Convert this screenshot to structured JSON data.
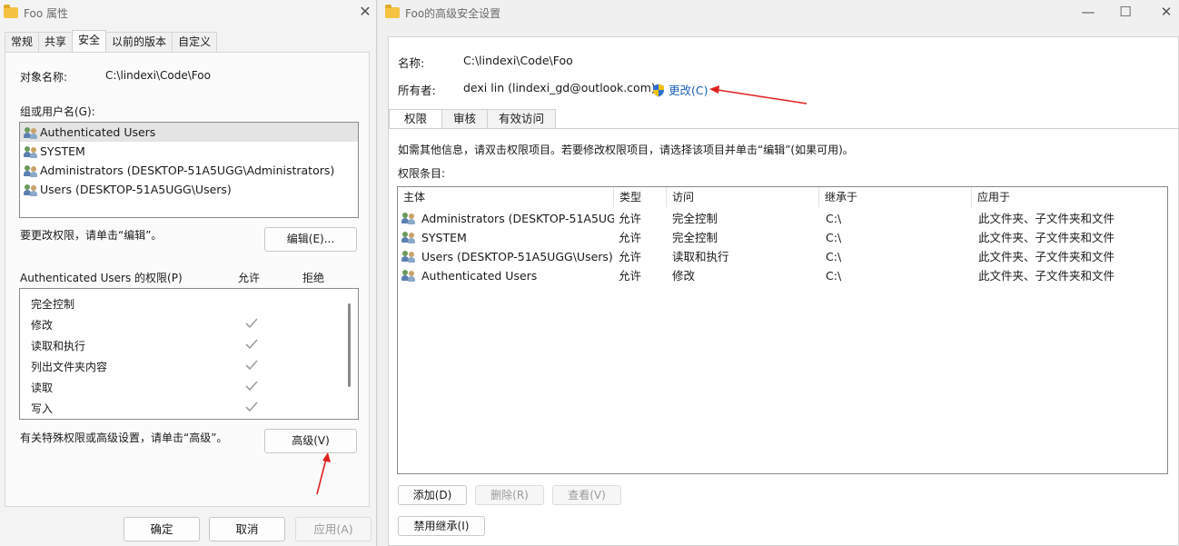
{
  "left_window": {
    "title": "Foo 属性",
    "close_glyph": "✕",
    "tabs": [
      "常规",
      "共享",
      "安全",
      "以前的版本",
      "自定义"
    ],
    "active_tab": "安全",
    "object_name_label": "对象名称:",
    "object_name_value": "C:\\lindexi\\Code\\Foo",
    "group_label": "组或用户名(G):",
    "users": [
      "Authenticated Users",
      "SYSTEM",
      "Administrators (DESKTOP-51A5UGG\\Administrators)",
      "Users (DESKTOP-51A5UGG\\Users)"
    ],
    "change_perm_text": "要更改权限，请单击“编辑”。",
    "edit_button": "编辑(E)...",
    "perm_header": "Authenticated Users 的权限(P)",
    "allow_header": "允许",
    "deny_header": "拒绝",
    "permissions": [
      {
        "name": "完全控制",
        "allow": false
      },
      {
        "name": "修改",
        "allow": true
      },
      {
        "name": "读取和执行",
        "allow": true
      },
      {
        "name": "列出文件夹内容",
        "allow": true
      },
      {
        "name": "读取",
        "allow": true
      },
      {
        "name": "写入",
        "allow": true
      }
    ],
    "special_text": "有关特殊权限或高级设置，请单击“高级”。",
    "advanced_button": "高级(V)",
    "ok_button": "确定",
    "cancel_button": "取消",
    "apply_button": "应用(A)"
  },
  "right_window": {
    "title": "Foo的高级安全设置",
    "minimize_glyph": "—",
    "maximize_glyph": "☐",
    "close_glyph": "✕",
    "name_label": "名称:",
    "name_value": "C:\\lindexi\\Code\\Foo",
    "owner_label": "所有者:",
    "owner_value": "dexi lin (lindexi_gd@outlook.com)",
    "change_link": "更改(C)",
    "tabs": [
      "权限",
      "审核",
      "有效访问"
    ],
    "active_tab": "权限",
    "info_text": "如需其他信息，请双击权限项目。若要修改权限项目，请选择该项目并单击“编辑”(如果可用)。",
    "entries_label": "权限条目:",
    "columns": [
      "主体",
      "类型",
      "访问",
      "继承于",
      "应用于"
    ],
    "rows": [
      [
        "Administrators (DESKTOP-51A5UG...",
        "允许",
        "完全控制",
        "C:\\",
        "此文件夹、子文件夹和文件"
      ],
      [
        "SYSTEM",
        "允许",
        "完全控制",
        "C:\\",
        "此文件夹、子文件夹和文件"
      ],
      [
        "Users (DESKTOP-51A5UGG\\Users)",
        "允许",
        "读取和执行",
        "C:\\",
        "此文件夹、子文件夹和文件"
      ],
      [
        "Authenticated Users",
        "允许",
        "修改",
        "C:\\",
        "此文件夹、子文件夹和文件"
      ]
    ],
    "add_button": "添加(D)",
    "remove_button": "删除(R)",
    "view_button": "查看(V)",
    "disable_inherit_button": "禁用继承(I)"
  },
  "annotation_color": "#e02020",
  "icons": [
    "folder-icon",
    "users-icon",
    "check-icon",
    "shield-icon",
    "close-icon",
    "minimize-icon",
    "maximize-icon",
    "arrow-icon"
  ]
}
